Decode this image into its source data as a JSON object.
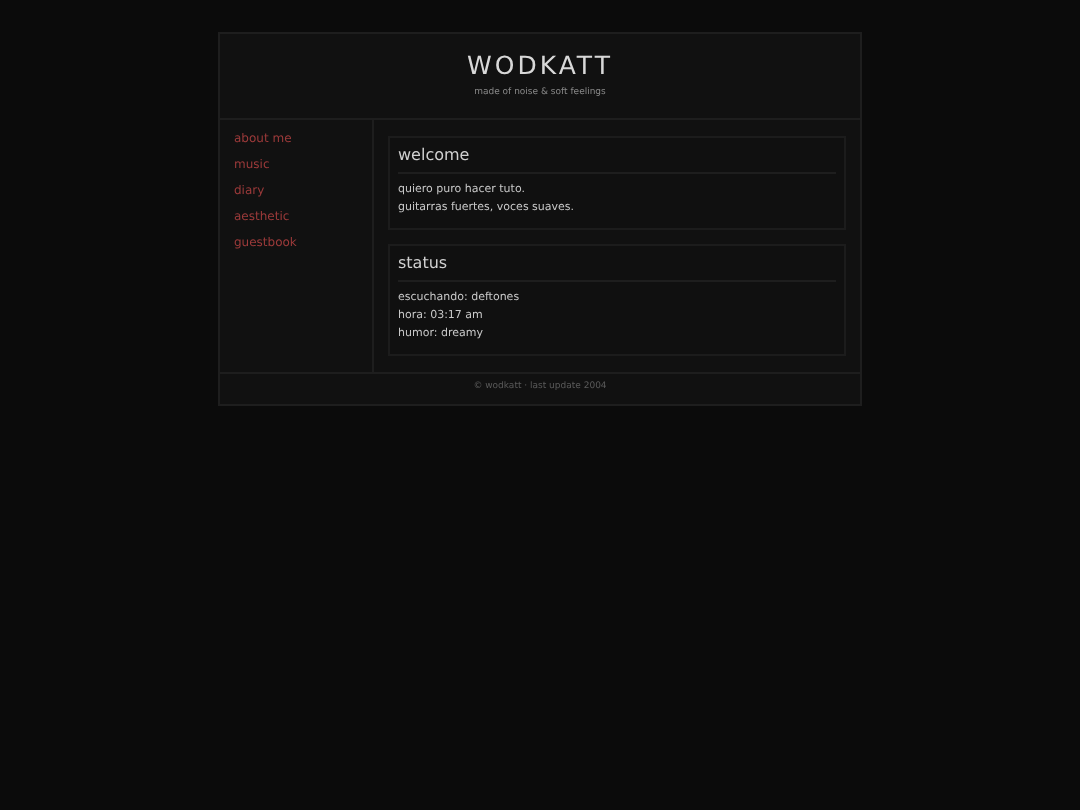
{
  "header": {
    "title": "WODKATT",
    "tagline": "made of noise & soft feelings"
  },
  "sidebar": {
    "items": [
      "about me",
      "music",
      "diary",
      "aesthetic",
      "guestbook"
    ]
  },
  "panels": [
    {
      "title": "welcome",
      "lines": [
        "quiero puro hacer tuto.",
        "guitarras fuertes, voces suaves."
      ]
    },
    {
      "title": "status",
      "lines": [
        "escuchando: deftones",
        "hora: 03:17 am",
        "humor: dreamy"
      ]
    }
  ],
  "footer": "© wodkatt · last update 2004"
}
